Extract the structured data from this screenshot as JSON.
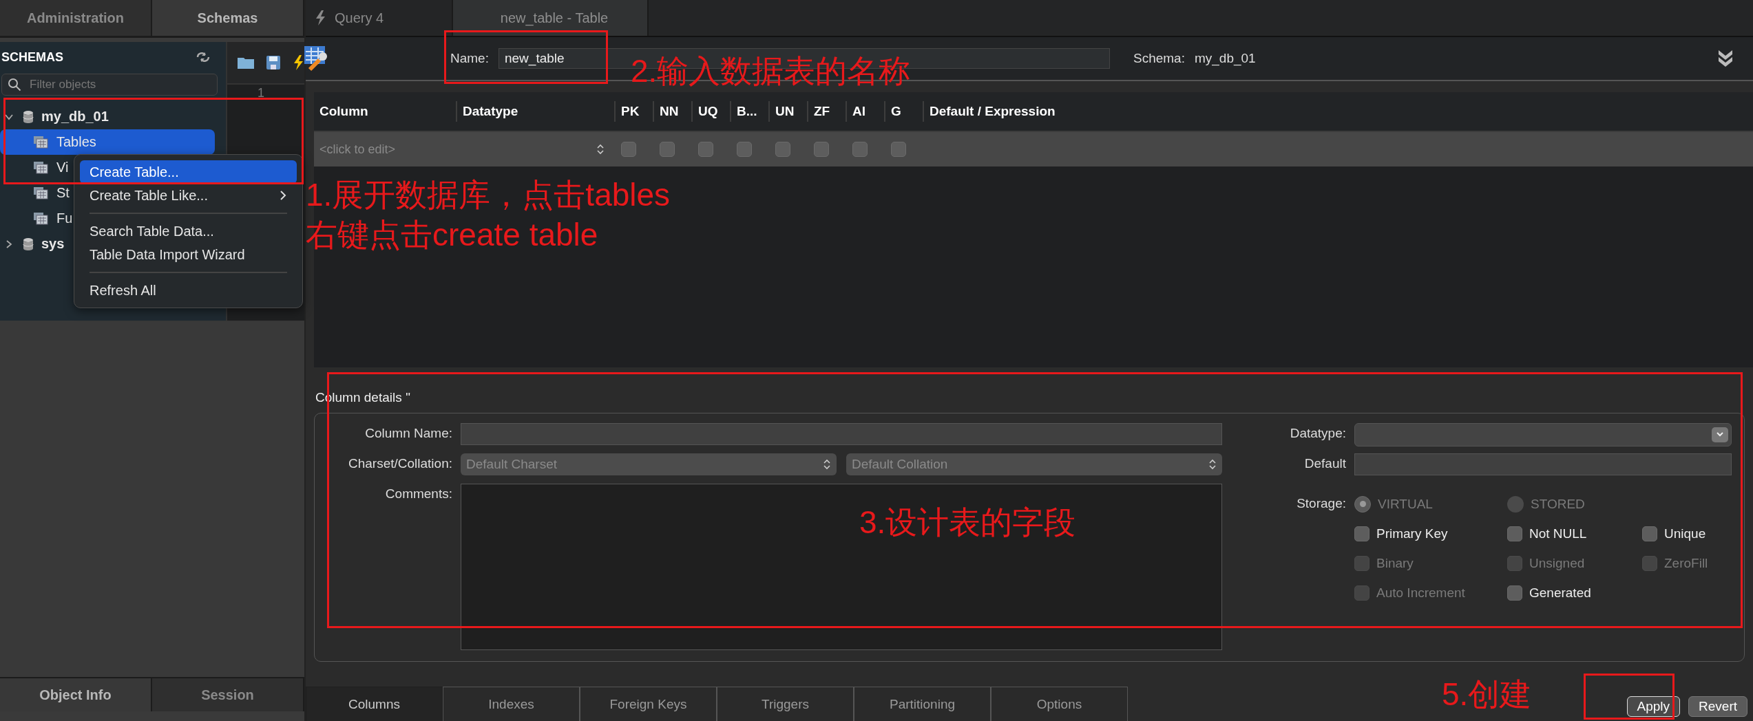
{
  "sidebar_tabs": [
    {
      "label": "Administration",
      "selected": false
    },
    {
      "label": "Schemas",
      "selected": true
    }
  ],
  "schemas_panel": {
    "title": "SCHEMAS",
    "filter": {
      "placeholder": "Filter objects"
    },
    "tree": [
      {
        "label": "my_db_01",
        "kind": "schema",
        "expanded": true,
        "selected": false,
        "children": [
          {
            "label": "Tables",
            "kind": "folder",
            "selected": true
          },
          {
            "label": "Vi",
            "kind": "folder",
            "selected": false
          },
          {
            "label": "St",
            "kind": "folder",
            "selected": false
          },
          {
            "label": "Fu",
            "kind": "folder",
            "selected": false
          }
        ]
      },
      {
        "label": "sys",
        "kind": "schema",
        "expanded": false,
        "selected": false
      }
    ]
  },
  "editor": {
    "line_numbers": [
      "1"
    ]
  },
  "context_menu": [
    {
      "kind": "item",
      "label": "Create Table...",
      "selected": true,
      "submenu": false
    },
    {
      "kind": "item",
      "label": "Create Table Like...",
      "selected": false,
      "submenu": true
    },
    {
      "kind": "separator"
    },
    {
      "kind": "item",
      "label": "Search Table Data...",
      "selected": false,
      "submenu": false
    },
    {
      "kind": "item",
      "label": "Table Data Import Wizard",
      "selected": false,
      "submenu": false
    },
    {
      "kind": "separator"
    },
    {
      "kind": "item",
      "label": "Refresh All",
      "selected": false,
      "submenu": false
    }
  ],
  "sidebar_bottom_tabs": [
    {
      "label": "Object Info",
      "selected": true
    },
    {
      "label": "Session",
      "selected": false
    }
  ],
  "editor_tabs": [
    {
      "label": "Query 4",
      "kind": "query",
      "selected": false
    },
    {
      "label": "new_table - Table",
      "kind": "table",
      "selected": true
    }
  ],
  "table_editor": {
    "name_label": "Name:",
    "name": "new_table",
    "schema_label": "Schema:",
    "schema": "my_db_01",
    "grid": {
      "columns": [
        "Column",
        "Datatype",
        "PK",
        "NN",
        "UQ",
        "B...",
        "UN",
        "ZF",
        "AI",
        "G",
        "Default / Expression"
      ],
      "rows": [
        {
          "placeholder": "<click to edit>",
          "flags": [
            false,
            false,
            false,
            false,
            false,
            false,
            false,
            false
          ]
        }
      ]
    },
    "column_details": {
      "title": "Column details ''",
      "column_name_label": "Column Name:",
      "charset_label": "Charset/Collation:",
      "charset": "Default Charset",
      "collation": "Default Collation",
      "comments_label": "Comments:",
      "datatype_label": "Datatype:",
      "default_label": "Default",
      "storage_label": "Storage:",
      "storage": [
        {
          "label": "VIRTUAL",
          "selected": true,
          "disabled": true
        },
        {
          "label": "STORED",
          "selected": false,
          "disabled": true
        }
      ],
      "options": [
        {
          "label": "Primary Key",
          "checked": false,
          "disabled": false
        },
        {
          "label": "Not NULL",
          "checked": false,
          "disabled": false
        },
        {
          "label": "Unique",
          "checked": false,
          "disabled": false
        },
        {
          "label": "Binary",
          "checked": false,
          "disabled": true
        },
        {
          "label": "Unsigned",
          "checked": false,
          "disabled": true
        },
        {
          "label": "ZeroFill",
          "checked": false,
          "disabled": true
        },
        {
          "label": "Auto Increment",
          "checked": false,
          "disabled": true
        },
        {
          "label": "Generated",
          "checked": false,
          "disabled": false
        }
      ]
    },
    "tabs": [
      {
        "label": "Columns",
        "selected": true
      },
      {
        "label": "Indexes",
        "selected": false
      },
      {
        "label": "Foreign Keys",
        "selected": false
      },
      {
        "label": "Triggers",
        "selected": false
      },
      {
        "label": "Partitioning",
        "selected": false
      },
      {
        "label": "Options",
        "selected": false
      }
    ],
    "buttons": [
      {
        "label": "Apply",
        "default": true
      },
      {
        "label": "Revert",
        "default": false
      }
    ]
  },
  "annotations": [
    {
      "lines": [
        "1.展开数据库，点击tables",
        "右键点击create table"
      ]
    },
    {
      "lines": [
        "2.输入数据表的名称"
      ]
    },
    {
      "lines": [
        "3.设计表的字段"
      ]
    },
    {
      "lines": [
        "5.创建"
      ]
    }
  ]
}
